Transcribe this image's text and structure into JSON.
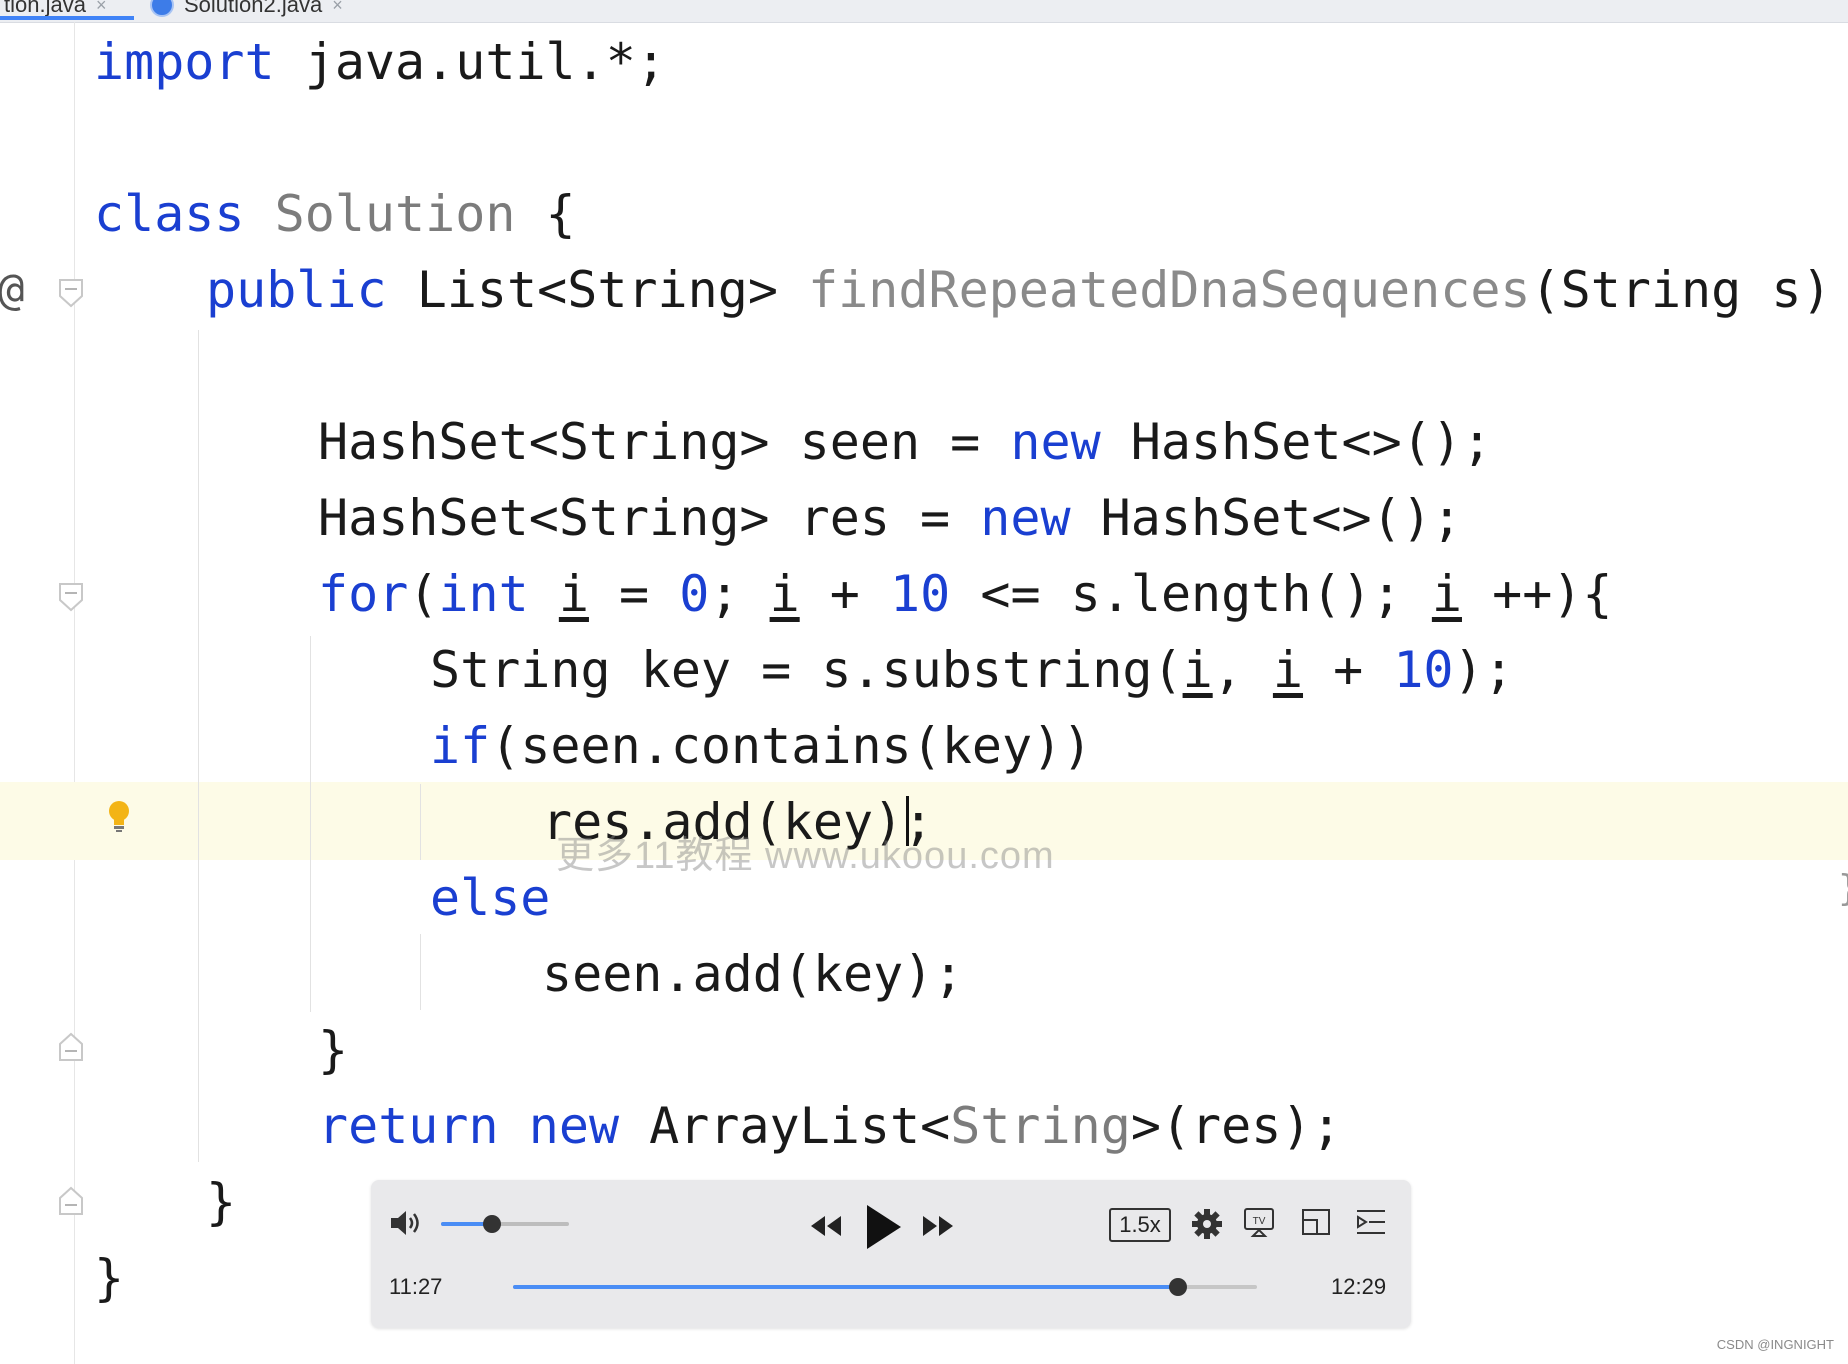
{
  "tabs": [
    {
      "label": "tion.java",
      "close": "×"
    },
    {
      "label": "Solution2.java",
      "close": "×"
    }
  ],
  "gutter": {
    "override_marker": "@"
  },
  "watermark": "更多11教程 www.ukoou.com",
  "player": {
    "current_time": "11:27",
    "total_time": "12:29",
    "speed": "1.5x",
    "volume_level": 0.4,
    "progress_level": 0.894,
    "icons": [
      "volume-icon",
      "rewind-icon",
      "play-icon",
      "fast-forward-icon",
      "settings-icon",
      "tv-cast-icon",
      "picture-in-picture-icon",
      "playlist-icon"
    ]
  },
  "credit": "CSDN @INGNIGHT",
  "colors": {
    "keyword": "#1a3fd1",
    "accent": "#4a8df5",
    "line_highlight": "#fdfbe7"
  }
}
